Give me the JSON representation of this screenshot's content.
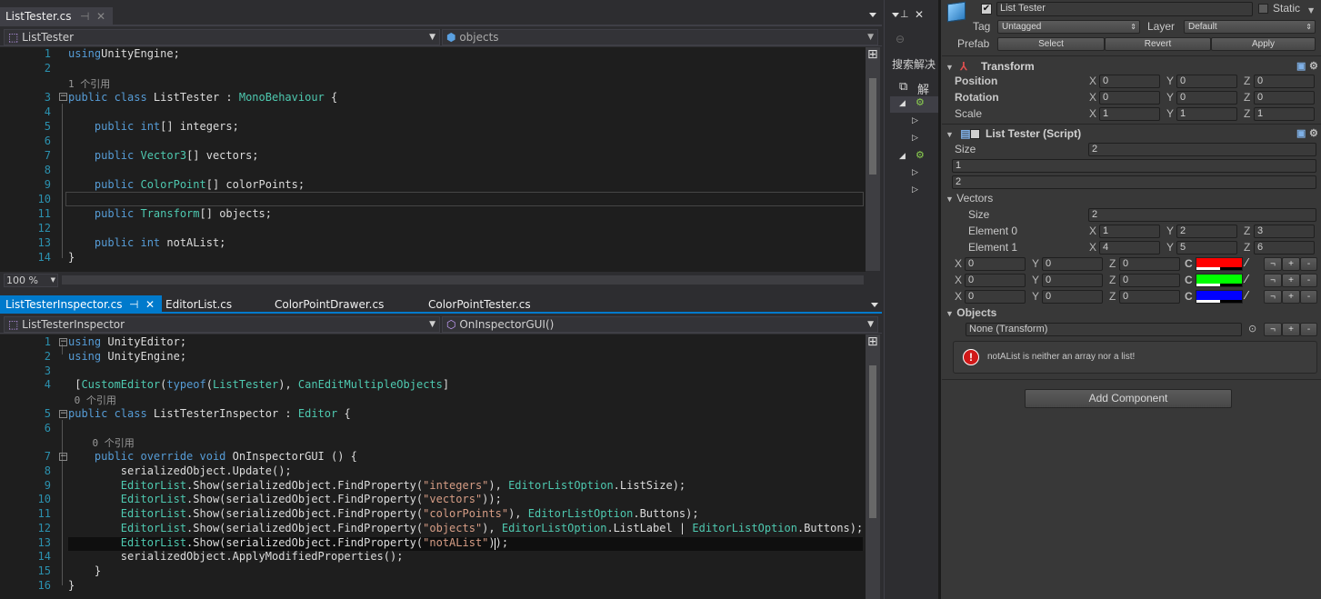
{
  "top_editor": {
    "tab_active": "ListTester.cs",
    "nav_left": "ListTester",
    "nav_right": "objects",
    "zoom": "100 %",
    "lines": [
      {
        "n": "1",
        "tokens": [
          [
            "k",
            "using"
          ],
          [
            "",
            "UnityEngine;"
          ]
        ]
      },
      {
        "n": "2",
        "tokens": []
      },
      {
        "n": "",
        "tokens": [
          [
            "r",
            "1 个引用"
          ]
        ]
      },
      {
        "n": "3",
        "tokens": [
          [
            "k",
            "public class "
          ],
          [
            "",
            "ListTester : "
          ],
          [
            "t",
            "MonoBehaviour"
          ],
          [
            "",
            " {"
          ]
        ]
      },
      {
        "n": "4",
        "tokens": []
      },
      {
        "n": "5",
        "tokens": [
          [
            "k",
            "    public int"
          ],
          [
            "",
            "[] integers;"
          ]
        ]
      },
      {
        "n": "6",
        "tokens": []
      },
      {
        "n": "7",
        "tokens": [
          [
            "k",
            "    public "
          ],
          [
            "t",
            "Vector3"
          ],
          [
            "",
            "[] vectors;"
          ]
        ]
      },
      {
        "n": "8",
        "tokens": []
      },
      {
        "n": "9",
        "tokens": [
          [
            "k",
            "    public "
          ],
          [
            "t",
            "ColorPoint"
          ],
          [
            "",
            "[] colorPoints;"
          ]
        ]
      },
      {
        "n": "10",
        "tokens": []
      },
      {
        "n": "11",
        "tokens": [
          [
            "k",
            "    public "
          ],
          [
            "t",
            "Transform"
          ],
          [
            "",
            "[] objects;"
          ]
        ]
      },
      {
        "n": "12",
        "tokens": []
      },
      {
        "n": "13",
        "tokens": [
          [
            "k",
            "    public int"
          ],
          [
            "",
            " notAList;"
          ]
        ]
      },
      {
        "n": "14",
        "tokens": [
          [
            "",
            "}"
          ]
        ]
      }
    ]
  },
  "bottom_editor": {
    "tabs": [
      "ListTesterInspector.cs",
      "EditorList.cs",
      "ColorPointDrawer.cs",
      "ColorPointTester.cs"
    ],
    "nav_left": "ListTesterInspector",
    "nav_right": "OnInspectorGUI()",
    "lines": [
      {
        "n": "1",
        "tokens": [
          [
            "k",
            "using"
          ],
          [
            "",
            " UnityEditor;"
          ]
        ]
      },
      {
        "n": "2",
        "tokens": [
          [
            "k",
            "using"
          ],
          [
            "",
            " UnityEngine;"
          ]
        ]
      },
      {
        "n": "3",
        "tokens": []
      },
      {
        "n": "4",
        "tokens": [
          [
            "",
            " ["
          ],
          [
            "t",
            "CustomEditor"
          ],
          [
            "",
            "("
          ],
          [
            "k",
            "typeof"
          ],
          [
            "",
            "("
          ],
          [
            "t",
            "ListTester"
          ],
          [
            "",
            "), "
          ],
          [
            "t",
            "CanEditMultipleObjects"
          ],
          [
            "",
            "]"
          ]
        ]
      },
      {
        "n": "",
        "tokens": [
          [
            "r",
            " 0 个引用"
          ]
        ]
      },
      {
        "n": "5",
        "tokens": [
          [
            "k",
            "public class "
          ],
          [
            "",
            "ListTesterInspector : "
          ],
          [
            "t",
            "Editor"
          ],
          [
            "",
            " {"
          ]
        ]
      },
      {
        "n": "6",
        "tokens": []
      },
      {
        "n": "",
        "tokens": [
          [
            "r",
            "    0 个引用"
          ]
        ]
      },
      {
        "n": "7",
        "tokens": [
          [
            "k",
            "    public override void "
          ],
          [
            "",
            "OnInspectorGUI () {"
          ]
        ]
      },
      {
        "n": "8",
        "tokens": [
          [
            "",
            "        serializedObject.Update();"
          ]
        ]
      },
      {
        "n": "9",
        "tokens": [
          [
            "t",
            "        EditorList"
          ],
          [
            "",
            ".Show(serializedObject.FindProperty("
          ],
          [
            "s",
            "\"integers\""
          ],
          [
            "",
            "), "
          ],
          [
            "t",
            "EditorListOption"
          ],
          [
            "",
            ".ListSize);"
          ]
        ]
      },
      {
        "n": "10",
        "tokens": [
          [
            "t",
            "        EditorList"
          ],
          [
            "",
            ".Show(serializedObject.FindProperty("
          ],
          [
            "s",
            "\"vectors\""
          ],
          [
            "",
            "));"
          ]
        ]
      },
      {
        "n": "11",
        "tokens": [
          [
            "t",
            "        EditorList"
          ],
          [
            "",
            ".Show(serializedObject.FindProperty("
          ],
          [
            "s",
            "\"colorPoints\""
          ],
          [
            "",
            "), "
          ],
          [
            "t",
            "EditorListOption"
          ],
          [
            "",
            ".Buttons);"
          ]
        ]
      },
      {
        "n": "12",
        "tokens": [
          [
            "t",
            "        EditorList"
          ],
          [
            "",
            ".Show(serializedObject.FindProperty("
          ],
          [
            "s",
            "\"objects\""
          ],
          [
            "",
            "), "
          ],
          [
            "t",
            "EditorListOption"
          ],
          [
            "",
            ".ListLabel | "
          ],
          [
            "t",
            "EditorListOption"
          ],
          [
            "",
            ".Buttons);"
          ]
        ]
      },
      {
        "n": "13",
        "tokens": [
          [
            "t",
            "        EditorList"
          ],
          [
            "",
            ".Show(serializedObject.FindProperty("
          ],
          [
            "s",
            "\"notAList\""
          ],
          [
            "",
            "));"
          ]
        ]
      },
      {
        "n": "14",
        "tokens": [
          [
            "",
            "        serializedObject.ApplyModifiedProperties();"
          ]
        ]
      },
      {
        "n": "15",
        "tokens": [
          [
            "",
            "    }"
          ]
        ]
      },
      {
        "n": "16",
        "tokens": [
          [
            "",
            "}"
          ]
        ]
      }
    ]
  },
  "solution_panel": {
    "search_label": "搜索解决",
    "solution_label": "解"
  },
  "inspector": {
    "object_name": "List Tester",
    "static_label": "Static",
    "tag_label": "Tag",
    "tag_value": "Untagged",
    "layer_label": "Layer",
    "layer_value": "Default",
    "prefab_label": "Prefab",
    "prefab_buttons": [
      "Select",
      "Revert",
      "Apply"
    ],
    "transform": {
      "title": "Transform",
      "rows": [
        {
          "label": "Position",
          "x": "0",
          "y": "0",
          "z": "0"
        },
        {
          "label": "Rotation",
          "x": "0",
          "y": "0",
          "z": "0"
        },
        {
          "label": "Scale",
          "x": "1",
          "y": "1",
          "z": "1"
        }
      ]
    },
    "script": {
      "title": "List Tester (Script)",
      "size_label": "Size",
      "size_value": "2",
      "integers": [
        "1",
        "2"
      ],
      "vectors_label": "Vectors",
      "vectors_size_label": "Size",
      "vectors_size_value": "2",
      "vector_elements": [
        {
          "label": "Element 0",
          "x": "1",
          "y": "2",
          "z": "3"
        },
        {
          "label": "Element 1",
          "x": "4",
          "y": "5",
          "z": "6"
        }
      ],
      "color_points": [
        {
          "x": "0",
          "y": "0",
          "z": "0",
          "color": "#ff0000"
        },
        {
          "x": "0",
          "y": "0",
          "z": "0",
          "color": "#00ff00"
        },
        {
          "x": "0",
          "y": "0",
          "z": "0",
          "color": "#0000ff"
        }
      ],
      "c_label": "C",
      "objects_label": "Objects",
      "objects_value": "None (Transform)",
      "error_text": "notAList is neither an array nor a list!"
    },
    "add_component": "Add Component",
    "axis": {
      "x": "X",
      "y": "Y",
      "z": "Z"
    },
    "btn_dup": "¬",
    "btn_add": "+",
    "btn_del": "-"
  }
}
